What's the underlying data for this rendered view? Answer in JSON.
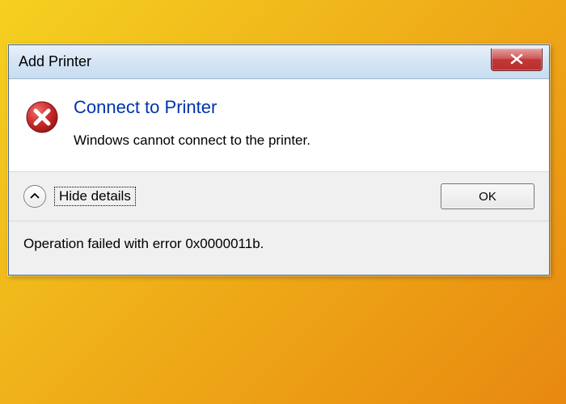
{
  "dialog": {
    "title": "Add Printer",
    "heading": "Connect to Printer",
    "message": "Windows cannot connect to the printer.",
    "details_toggle_label": "Hide details",
    "ok_label": "OK",
    "details_text": "Operation failed with error 0x0000011b."
  },
  "colors": {
    "heading": "#0033aa",
    "error_icon_bg": "#cc2b2b",
    "close_btn": "#c13838"
  }
}
